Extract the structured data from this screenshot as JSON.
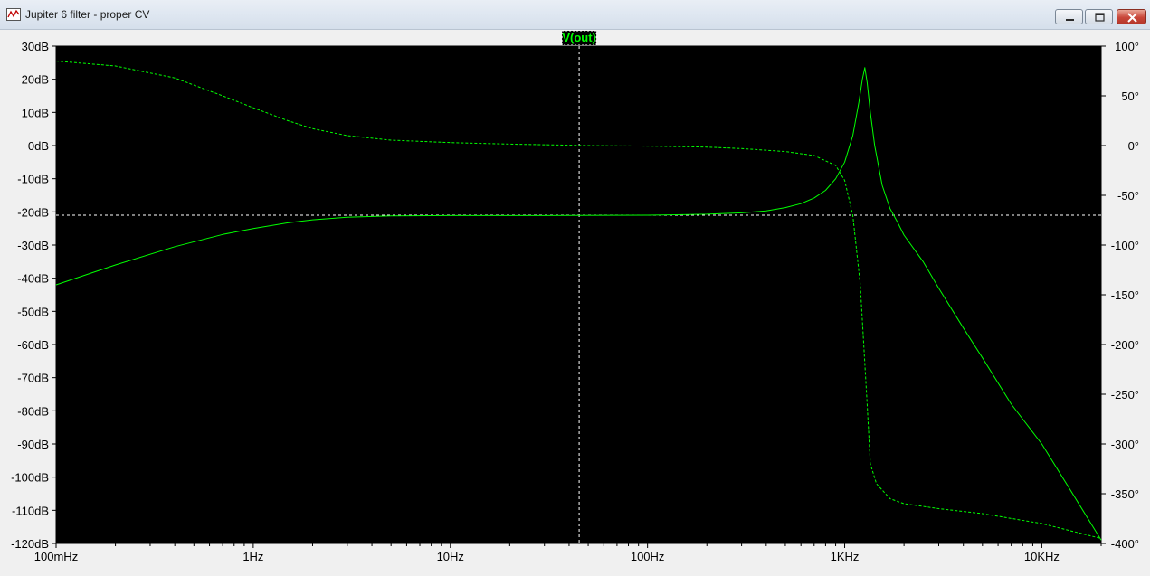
{
  "window": {
    "title": "Jupiter 6 filter - proper CV",
    "buttons": {
      "minimize": "minimize",
      "maximize": "maximize",
      "close": "close"
    }
  },
  "colors": {
    "background": "#000000",
    "trace": "#00ff00",
    "cursor": "#ffffff",
    "frame": "#f0f0f0"
  },
  "chart_data": {
    "type": "line",
    "title": "",
    "trace_label": "V(out)",
    "xscale": "log",
    "xlim": [
      0.1,
      20000
    ],
    "x_ticks": [
      {
        "value": 0.1,
        "label": "100mHz"
      },
      {
        "value": 1,
        "label": "1Hz"
      },
      {
        "value": 10,
        "label": "10Hz"
      },
      {
        "value": 100,
        "label": "100Hz"
      },
      {
        "value": 1000,
        "label": "1KHz"
      },
      {
        "value": 10000,
        "label": "10KHz"
      }
    ],
    "y_left": {
      "unit": "dB",
      "ylim": [
        -120,
        30
      ],
      "ticks": [
        "30dB",
        "20dB",
        "10dB",
        "0dB",
        "-10dB",
        "-20dB",
        "-30dB",
        "-40dB",
        "-50dB",
        "-60dB",
        "-70dB",
        "-80dB",
        "-90dB",
        "-100dB",
        "-110dB",
        "-120dB"
      ],
      "values": [
        30,
        20,
        10,
        0,
        -10,
        -20,
        -30,
        -40,
        -50,
        -60,
        -70,
        -80,
        -90,
        -100,
        -110,
        -120
      ]
    },
    "y_right": {
      "unit": "deg",
      "ylim": [
        -400,
        100
      ],
      "ticks": [
        "100°",
        "50°",
        "0°",
        "-50°",
        "-100°",
        "-150°",
        "-200°",
        "-250°",
        "-300°",
        "-350°",
        "-400°"
      ],
      "values": [
        100,
        50,
        0,
        -50,
        -100,
        -150,
        -200,
        -250,
        -300,
        -350,
        -400
      ]
    },
    "cursor": {
      "x": 45,
      "y_db": -21
    },
    "series": [
      {
        "name": "V(out)",
        "quantity": "magnitude",
        "axis": "left",
        "style": "solid",
        "points": [
          [
            0.1,
            -42
          ],
          [
            0.2,
            -36
          ],
          [
            0.4,
            -30.5
          ],
          [
            0.7,
            -26.8
          ],
          [
            1,
            -25
          ],
          [
            1.5,
            -23.3
          ],
          [
            2,
            -22.4
          ],
          [
            3,
            -21.6
          ],
          [
            5,
            -21.2
          ],
          [
            10,
            -21.1
          ],
          [
            30,
            -21.1
          ],
          [
            100,
            -21.0
          ],
          [
            200,
            -20.7
          ],
          [
            300,
            -20.3
          ],
          [
            400,
            -19.7
          ],
          [
            500,
            -18.7
          ],
          [
            600,
            -17.5
          ],
          [
            700,
            -15.8
          ],
          [
            800,
            -13.5
          ],
          [
            900,
            -10
          ],
          [
            1000,
            -5
          ],
          [
            1100,
            3
          ],
          [
            1180,
            13
          ],
          [
            1230,
            20
          ],
          [
            1265,
            23.5
          ],
          [
            1300,
            19
          ],
          [
            1350,
            10
          ],
          [
            1420,
            0
          ],
          [
            1550,
            -12
          ],
          [
            1700,
            -19
          ],
          [
            1850,
            -23
          ],
          [
            2000,
            -27
          ],
          [
            2500,
            -35
          ],
          [
            3000,
            -43
          ],
          [
            4000,
            -55
          ],
          [
            5000,
            -64
          ],
          [
            7000,
            -78
          ],
          [
            10000,
            -90
          ],
          [
            14000,
            -104
          ],
          [
            20000,
            -119
          ]
        ]
      },
      {
        "name": "V(out)",
        "quantity": "phase",
        "axis": "right",
        "style": "dashed",
        "points": [
          [
            0.1,
            85
          ],
          [
            0.2,
            80
          ],
          [
            0.4,
            68
          ],
          [
            0.7,
            50
          ],
          [
            1,
            38
          ],
          [
            1.5,
            25
          ],
          [
            2,
            17
          ],
          [
            3,
            10
          ],
          [
            5,
            5.5
          ],
          [
            10,
            3
          ],
          [
            20,
            1.5
          ],
          [
            50,
            0
          ],
          [
            100,
            -0.5
          ],
          [
            200,
            -1.5
          ],
          [
            300,
            -3
          ],
          [
            500,
            -6
          ],
          [
            700,
            -10
          ],
          [
            900,
            -20
          ],
          [
            1000,
            -35
          ],
          [
            1100,
            -70
          ],
          [
            1200,
            -140
          ],
          [
            1250,
            -200
          ],
          [
            1300,
            -260
          ],
          [
            1350,
            -320
          ],
          [
            1450,
            -340
          ],
          [
            1700,
            -355
          ],
          [
            2000,
            -360
          ],
          [
            3000,
            -365
          ],
          [
            5000,
            -370
          ],
          [
            10000,
            -380
          ],
          [
            20000,
            -395
          ]
        ]
      }
    ]
  }
}
